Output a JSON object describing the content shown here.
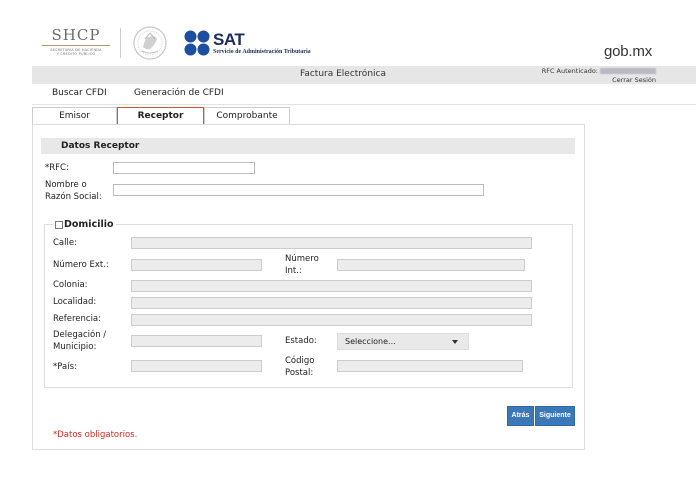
{
  "header": {
    "shcp_title": "SHCP",
    "shcp_subtitle_1": "SECRETARÍA DE HACIENDA",
    "shcp_subtitle_2": "Y CRÉDITO PÚBLICO",
    "sat_title": "SAT",
    "sat_subtitle": "Servicio de Administración Tributaria",
    "gob_logo": "gob.mx"
  },
  "topbar": {
    "title": "Factura Electrónica",
    "rfc_label": "RFC Autenticado:",
    "logout": "Cerrar Sesión"
  },
  "mainnav": {
    "items": [
      "Buscar CFDI",
      "Generación de CFDI"
    ]
  },
  "tabs": [
    {
      "label": "Emisor",
      "active": false
    },
    {
      "label": "Receptor",
      "active": true
    },
    {
      "label": "Comprobante",
      "active": false
    }
  ],
  "form": {
    "section_title": "Datos Receptor",
    "rfc_label": "*RFC:",
    "nombre_label_1": "Nombre o",
    "nombre_label_2": "Razón Social:",
    "domicilio_title": "Domicilio",
    "calle_label": "Calle:",
    "num_ext_label": "Número Ext.:",
    "num_int_label_1": "Número",
    "num_int_label_2": "Int.:",
    "colonia_label": "Colonia:",
    "localidad_label": "Localidad:",
    "referencia_label": "Referencia:",
    "delegacion_label_1": "Delegación /",
    "delegacion_label_2": "Municipio:",
    "estado_label": "Estado:",
    "estado_value": "Seleccione...",
    "pais_label": "*País:",
    "cp_label_1": "Código",
    "cp_label_2": "Postal:"
  },
  "buttons": {
    "back": "Atrás",
    "next": "Siguiente"
  },
  "required_note": "*Datos obligatorios.",
  "colors": {
    "accent_tab": "#d9542a",
    "button": "#3a78b8",
    "required": "#d9261c",
    "sat_blue": "#1d2b5e"
  }
}
